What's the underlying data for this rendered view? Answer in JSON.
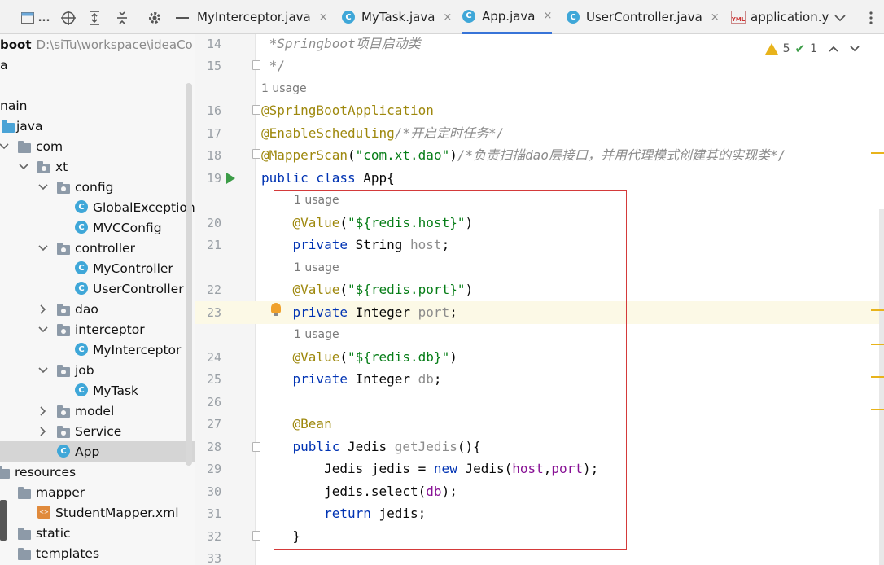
{
  "toolbar": {
    "dots": "...",
    "icons": [
      "window-icon",
      "crosshair-icon",
      "expand-all-icon",
      "collapse-all-icon",
      "gear-icon",
      "minimize-icon"
    ]
  },
  "tabs": [
    {
      "label": "MyInterceptor.java",
      "icon": "class",
      "active": false
    },
    {
      "label": "MyTask.java",
      "icon": "class",
      "active": false
    },
    {
      "label": "App.java",
      "icon": "class",
      "active": true
    },
    {
      "label": "UserController.java",
      "icon": "class",
      "active": false
    },
    {
      "label": "application.y",
      "icon": "yml",
      "active": false
    }
  ],
  "tab_icon_letter": "C",
  "tab_yml_text": "YML",
  "tab_close": "×",
  "project": {
    "root_name": "boot",
    "root_path": "D:\\siTu\\workspace\\ideaCo",
    "rows": [
      {
        "label": "a",
        "type": "none",
        "selected": false
      },
      {
        "label": "",
        "type": "none",
        "selected": false
      },
      {
        "label": "nain",
        "type": "none",
        "selected": false
      },
      {
        "label": "java",
        "type": "src",
        "selected": false
      },
      {
        "label": "com",
        "type": "folder",
        "selected": false
      },
      {
        "label": "xt",
        "type": "pkg",
        "selected": false
      },
      {
        "label": "config",
        "type": "pkg",
        "selected": false
      },
      {
        "label": "GlobalExceptionH",
        "type": "class",
        "selected": false
      },
      {
        "label": "MVCConfig",
        "type": "class",
        "selected": false
      },
      {
        "label": "controller",
        "type": "pkg",
        "selected": false
      },
      {
        "label": "MyController",
        "type": "class",
        "selected": false
      },
      {
        "label": "UserController",
        "type": "class",
        "selected": false
      },
      {
        "label": "dao",
        "type": "pkg",
        "selected": false
      },
      {
        "label": "interceptor",
        "type": "pkg",
        "selected": false
      },
      {
        "label": "MyInterceptor",
        "type": "class",
        "selected": false
      },
      {
        "label": "job",
        "type": "pkg",
        "selected": false
      },
      {
        "label": "MyTask",
        "type": "class",
        "selected": false
      },
      {
        "label": "model",
        "type": "pkg",
        "selected": false
      },
      {
        "label": "Service",
        "type": "pkg",
        "selected": false
      },
      {
        "label": "App",
        "type": "main-class",
        "selected": true
      },
      {
        "label": "resources",
        "type": "folder",
        "selected": false
      },
      {
        "label": "mapper",
        "type": "folder",
        "selected": false
      },
      {
        "label": "StudentMapper.xml",
        "type": "xml",
        "selected": false
      },
      {
        "label": "static",
        "type": "folder",
        "selected": false
      },
      {
        "label": "templates",
        "type": "folder",
        "selected": false
      }
    ],
    "class_letter": "C",
    "xml_letter": "<>"
  },
  "editor": {
    "inspection": {
      "warnings": "5",
      "ok": "1"
    },
    "usage_hint": "1 usage",
    "lines": [
      {
        "n": "14",
        "segs": [
          {
            "t": " *",
            "c": "gray"
          },
          {
            "t": "Springboot",
            "c": "cmt"
          },
          {
            "t": "项目启动类",
            "c": "cmt"
          }
        ]
      },
      {
        "n": "15",
        "segs": [
          {
            "t": " */",
            "c": "gray"
          }
        ]
      },
      {
        "n": "16",
        "segs": [
          {
            "t": "@SpringBootApplication",
            "c": "ann"
          }
        ]
      },
      {
        "n": "17",
        "segs": [
          {
            "t": "@EnableScheduling",
            "c": "ann"
          },
          {
            "t": "/*开启定时任务*/",
            "c": "cmt"
          }
        ]
      },
      {
        "n": "18",
        "segs": [
          {
            "t": "@MapperScan",
            "c": "ann"
          },
          {
            "t": "(",
            "c": ""
          },
          {
            "t": "\"com.xt.dao\"",
            "c": "str"
          },
          {
            "t": ")",
            "c": ""
          },
          {
            "t": "/*负责扫描dao层接口，并用代理模式创建其的实现类*/",
            "c": "cmt"
          }
        ]
      },
      {
        "n": "19",
        "segs": [
          {
            "t": "public class ",
            "c": "kw"
          },
          {
            "t": "App{",
            "c": ""
          }
        ]
      },
      {
        "n": "20",
        "segs": [
          {
            "t": "    @Value",
            "c": "ann"
          },
          {
            "t": "(",
            "c": ""
          },
          {
            "t": "\"${redis.host}\"",
            "c": "str"
          },
          {
            "t": ")",
            "c": ""
          }
        ]
      },
      {
        "n": "21",
        "segs": [
          {
            "t": "    private ",
            "c": "kw"
          },
          {
            "t": "String ",
            "c": ""
          },
          {
            "t": "host",
            "c": "gray"
          },
          {
            "t": ";",
            "c": ""
          }
        ]
      },
      {
        "n": "22",
        "segs": [
          {
            "t": "    @Value",
            "c": "ann"
          },
          {
            "t": "(",
            "c": ""
          },
          {
            "t": "\"${redis.port}\"",
            "c": "str"
          },
          {
            "t": ")",
            "c": ""
          }
        ]
      },
      {
        "n": "23",
        "segs": [
          {
            "t": "    private ",
            "c": "kw"
          },
          {
            "t": "Integer ",
            "c": ""
          },
          {
            "t": "port",
            "c": "gray"
          },
          {
            "t": ";",
            "c": ""
          }
        ]
      },
      {
        "n": "24",
        "segs": [
          {
            "t": "    @Value",
            "c": "ann"
          },
          {
            "t": "(",
            "c": ""
          },
          {
            "t": "\"${redis.db}\"",
            "c": "str"
          },
          {
            "t": ")",
            "c": ""
          }
        ]
      },
      {
        "n": "25",
        "segs": [
          {
            "t": "    private ",
            "c": "kw"
          },
          {
            "t": "Integer ",
            "c": ""
          },
          {
            "t": "db",
            "c": "gray"
          },
          {
            "t": ";",
            "c": ""
          }
        ]
      },
      {
        "n": "26",
        "segs": []
      },
      {
        "n": "27",
        "segs": [
          {
            "t": "    @Bean",
            "c": "ann"
          }
        ]
      },
      {
        "n": "28",
        "segs": [
          {
            "t": "    public ",
            "c": "kw"
          },
          {
            "t": "Jedis ",
            "c": ""
          },
          {
            "t": "getJedis",
            "c": "gray"
          },
          {
            "t": "(){",
            "c": ""
          }
        ]
      },
      {
        "n": "29",
        "segs": [
          {
            "t": "        Jedis jedis = ",
            "c": ""
          },
          {
            "t": "new ",
            "c": "kw"
          },
          {
            "t": "Jedis(",
            "c": ""
          },
          {
            "t": "host",
            "c": "fld"
          },
          {
            "t": ",",
            "c": ""
          },
          {
            "t": "port",
            "c": "fld"
          },
          {
            "t": ");",
            "c": ""
          }
        ]
      },
      {
        "n": "30",
        "segs": [
          {
            "t": "        jedis.select(",
            "c": ""
          },
          {
            "t": "db",
            "c": "fld"
          },
          {
            "t": ");",
            "c": ""
          }
        ]
      },
      {
        "n": "31",
        "segs": [
          {
            "t": "        return ",
            "c": "kw"
          },
          {
            "t": "jedis;",
            "c": ""
          }
        ]
      },
      {
        "n": "32",
        "segs": [
          {
            "t": "    }",
            "c": ""
          }
        ]
      },
      {
        "n": "33",
        "segs": []
      }
    ]
  },
  "colors": {
    "accent": "#3874d8",
    "highlight_box": "#d43a3a",
    "annotation": "#9e880d",
    "string": "#067d17",
    "keyword": "#0033b3"
  }
}
